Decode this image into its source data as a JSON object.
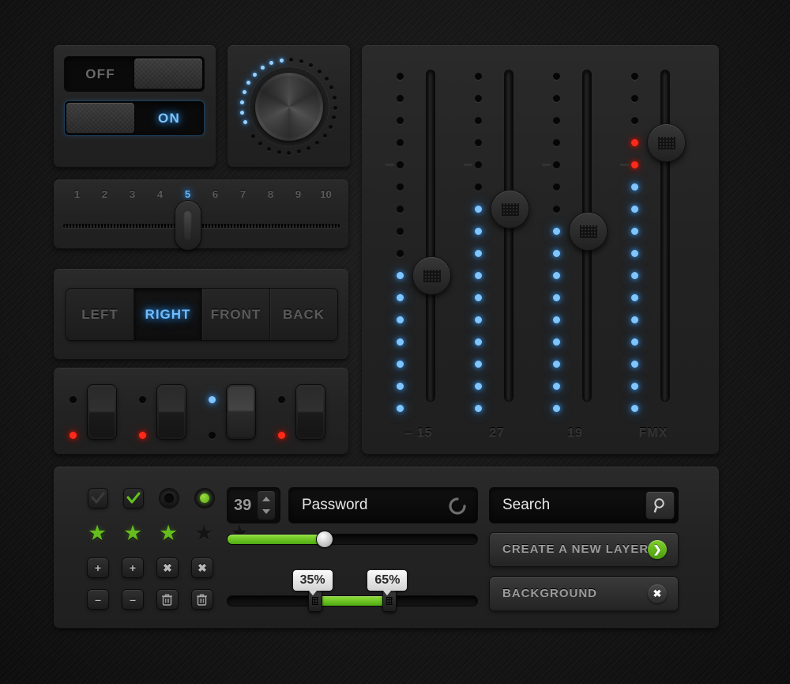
{
  "toggles": {
    "off": {
      "label": "OFF",
      "state": "off"
    },
    "on": {
      "label": "ON",
      "state": "on"
    }
  },
  "knob": {
    "name": "rotary-knob",
    "total_dots": 28,
    "lit_dots": 9,
    "accent": "#9ad2ff"
  },
  "number_slider": {
    "ticks": [
      "1",
      "2",
      "3",
      "4",
      "5",
      "6",
      "7",
      "8",
      "9",
      "10"
    ],
    "value": "5",
    "active_index": 4,
    "accent": "#66b8ff"
  },
  "segmented": {
    "options": [
      "LEFT",
      "RIGHT",
      "FRONT",
      "BACK"
    ],
    "selected": "RIGHT",
    "selected_index": 1,
    "accent": "#6fbcff"
  },
  "rockers": [
    {
      "top_led": "dark",
      "bottom_led": "red",
      "position": "down"
    },
    {
      "top_led": "dark",
      "bottom_led": "red",
      "position": "down"
    },
    {
      "top_led": "blue",
      "bottom_led": "dark",
      "position": "up"
    },
    {
      "top_led": "dark",
      "bottom_led": "red",
      "position": "down"
    }
  ],
  "mixer": {
    "channels": [
      {
        "label": "– 15",
        "leds_total": 16,
        "leds_dark": 9,
        "leds_red": 0,
        "leds_blue": 7,
        "handle_index": 9
      },
      {
        "label": "27",
        "leds_total": 16,
        "leds_dark": 6,
        "leds_red": 0,
        "leds_blue": 10,
        "handle_index": 6
      },
      {
        "label": "19",
        "leds_total": 16,
        "leds_dark": 7,
        "leds_red": 0,
        "leds_blue": 9,
        "handle_index": 7
      },
      {
        "label": "FMX",
        "leds_total": 16,
        "leds_dark": 3,
        "leds_red": 2,
        "leds_blue": 11,
        "handle_index": 3
      }
    ],
    "led_blue": "#7fc5ff",
    "led_red": "#ff2a1a"
  },
  "form": {
    "checkboxes": [
      {
        "name": "checkbox-unchecked",
        "checked": false
      },
      {
        "name": "checkbox-checked",
        "checked": true
      }
    ],
    "radios": [
      {
        "name": "radio-off",
        "selected": false
      },
      {
        "name": "radio-on",
        "selected": true
      }
    ],
    "rating": {
      "value": 3,
      "max": 5,
      "glyph": "★",
      "accent": "#65bd1e"
    },
    "icon_buttons_row1": [
      "+",
      "+",
      "✖",
      "✖"
    ],
    "icon_buttons_row2": [
      "–",
      "–",
      "trash",
      "trash"
    ],
    "spinner": {
      "value": "39"
    },
    "password": {
      "value": "Password",
      "icon": "refresh-icon"
    },
    "search": {
      "placeholder": "Search",
      "value": "Search",
      "icon": "search-icon"
    },
    "volume_slider": {
      "value": 39,
      "fill_percent": 39,
      "accent": "#8fe03a"
    },
    "range_slider": {
      "low_label": "35%",
      "high_label": "65%",
      "low": 35,
      "high": 65,
      "accent": "#8fe03a"
    },
    "create_layer": {
      "label": "CREATE A NEW LAYER",
      "icon": "chevron-right-icon"
    },
    "background_item": {
      "label": "BACKGROUND",
      "icon": "close-icon"
    }
  }
}
